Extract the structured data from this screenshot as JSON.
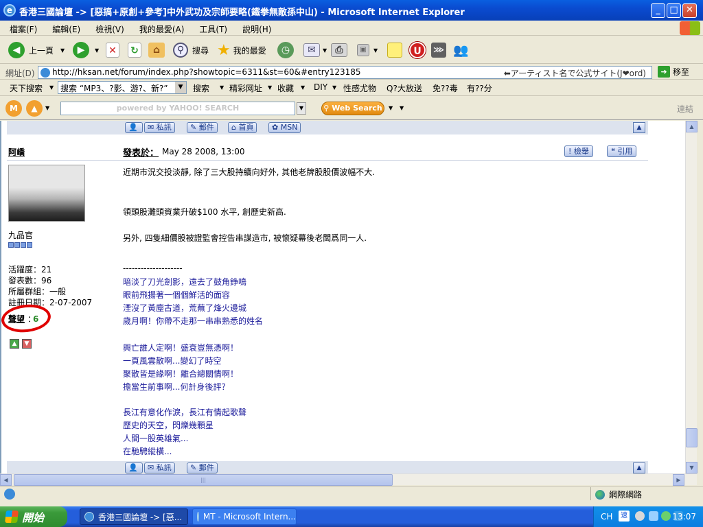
{
  "window": {
    "title": "香港三國論壇 -> [惡搞+原創+參考]中外武功及宗師要略(鐵拳無敵孫中山) - Microsoft Internet Explorer",
    "minimize": "_",
    "maximize": "□",
    "close": "✕"
  },
  "menu": [
    "檔案(F)",
    "編輯(E)",
    "檢視(V)",
    "我的最愛(A)",
    "工具(T)",
    "說明(H)"
  ],
  "toolbar": {
    "back": "上一頁",
    "search": "搜尋",
    "favorites": "我的最愛"
  },
  "address": {
    "label": "網址(D)",
    "url": "http://hksan.net/forum/index.php?showtopic=6311&st=60&#entry123185",
    "hint": "⬅アーティスト名で公式サイト(J❤ord)",
    "go": "移至"
  },
  "links": {
    "search_label": "天下搜索",
    "search_box": "搜索 “MP3、?影、游?、新?”",
    "items": [
      "搜索",
      "精彩网址",
      "收藏",
      "DIY",
      "性感尤物",
      "Q?大放送",
      "免??毒",
      "有??分"
    ]
  },
  "yahoo": {
    "placeholder": "powered by YAHOO! SEARCH",
    "web_search": "Web Search",
    "connect": "連結"
  },
  "post_buttons_top": [
    "私訊",
    "郵件",
    "首頁",
    "MSN"
  ],
  "post_buttons_bottom": [
    "私訊",
    "郵件"
  ],
  "post": {
    "author": "阿嶠",
    "posted_label": "發表於：",
    "date": "May 28 2008, 13:00",
    "report": "檢舉",
    "quote": "引用",
    "rank": "九品官",
    "stats": [
      "活躍度：21",
      "發表數：96",
      "所屬群組：一般",
      "註冊日期：2-07-2007"
    ],
    "reputation_label": "聲望",
    "reputation_sep": "：",
    "reputation_value": "6",
    "body": [
      "近期市況交投淡靜, 除了三大股持續向好外, 其他老牌股股價波幅不大.",
      "領頭股灘頭資業升破$100 水平, 創歷史新高.",
      "另外, 四隻細價股被證監會控告串謀造市, 被懷疑幕後老闆爲同一人."
    ],
    "divider": "--------------------",
    "signature": [
      "暗淡了刀光劍影，遠去了鼓角錚鳴",
      "眼前飛揚著一個個鮮活的面容",
      "湮沒了黃塵古道，荒蕪了烽火邊城",
      "歲月啊！你帶不走那一串串熟悉的姓名",
      "興亡誰人定啊！盛衰豈無憑啊！",
      "一頁風雲散啊...變幻了時空",
      "聚散皆是緣啊！離合總關情啊！",
      "擔當生前事啊...何計身後評？",
      "長江有意化作淚，長江有情起歌聲",
      "歷史的天空，閃爍幾顆星",
      "人間一股英雄氣...",
      "在馳騁縱橫..."
    ]
  },
  "status": {
    "zone": "網際網路"
  },
  "taskbar": {
    "start": "開始",
    "tasks": [
      "香港三國論壇 -> [惡...",
      "MT - Microsoft Intern..."
    ],
    "ime": "CH",
    "ime2": "速",
    "clock": "13:07"
  }
}
